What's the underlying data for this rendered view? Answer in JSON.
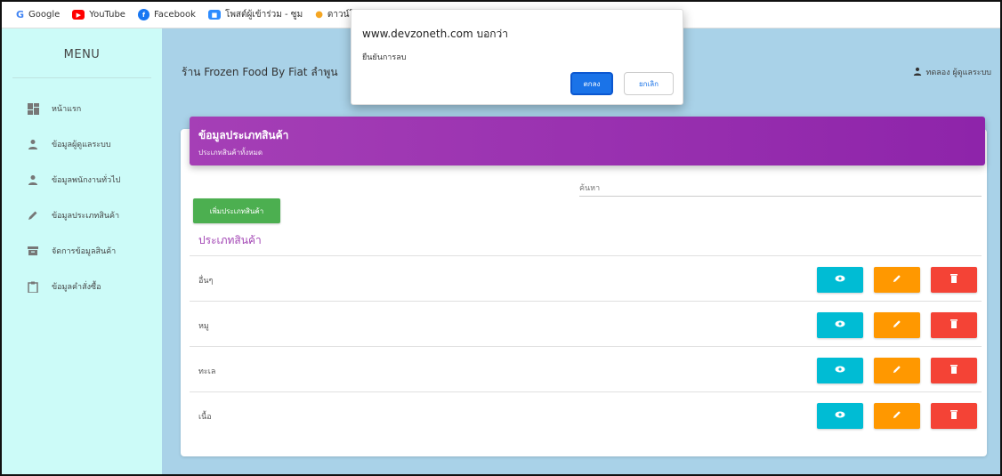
{
  "bookmarks": [
    {
      "label": "Google",
      "icon": "google-icon",
      "color": "#4285f4",
      "glyph": "G"
    },
    {
      "label": "YouTube",
      "icon": "youtube-icon",
      "color": "#ff0000",
      "glyph": "▶"
    },
    {
      "label": "Facebook",
      "icon": "facebook-icon",
      "color": "#1877f2",
      "glyph": "f"
    },
    {
      "label": "โพสต์ผู้เข้าร่วม - ซูม",
      "icon": "zoom-icon",
      "color": "#2d8cff",
      "glyph": "▪"
    },
    {
      "label": "ดาวน์โ",
      "icon": "bookmark-icon",
      "color": "#f5a623",
      "glyph": "●"
    }
  ],
  "sidebar": {
    "title": "MENU",
    "items": [
      {
        "label": "หน้าแรก",
        "icon": "dashboard-icon"
      },
      {
        "label": "ข้อมูลผู้ดูแลระบบ",
        "icon": "person-icon"
      },
      {
        "label": "ข้อมูลพนักงานทั่วไป",
        "icon": "person-icon"
      },
      {
        "label": "ข้อมูลประเภทสินค้า",
        "icon": "pencil-icon"
      },
      {
        "label": "จัดการข้อมูลสินค้า",
        "icon": "archive-icon"
      },
      {
        "label": "ข้อมูลคำสั่งซื้อ",
        "icon": "clipboard-icon"
      }
    ]
  },
  "header": {
    "shop_title": "ร้าน Frozen Food By Fiat ลำพูน",
    "user_label": "ทดลอง ผู้ดูแลระบบ"
  },
  "card": {
    "title": "ข้อมูลประเภทสินค้า",
    "subtitle": "ประเภทสินค้าทั้งหมด",
    "search_placeholder": "ค้นหา",
    "add_button": "เพิ่มประเภทสินค้า",
    "list_heading": "ประเภทสินค้า",
    "rows": [
      {
        "label": "อื่นๆ"
      },
      {
        "label": "หมู"
      },
      {
        "label": "ทะเล"
      },
      {
        "label": "เนื้อ"
      }
    ]
  },
  "dialog": {
    "origin": "www.devzoneth.com บอกว่า",
    "message": "ยืนยันการลบ",
    "ok_label": "ตกลง",
    "cancel_label": "ยกเลิก"
  },
  "colors": {
    "sidebar_bg": "#ccfbf8",
    "main_bg": "#a9d2e8",
    "header_purple": "#9c27b0",
    "add_green": "#4caf50",
    "view_cyan": "#00bcd4",
    "edit_orange": "#ff9800",
    "delete_red": "#f44336",
    "dialog_blue": "#1a73e8"
  }
}
